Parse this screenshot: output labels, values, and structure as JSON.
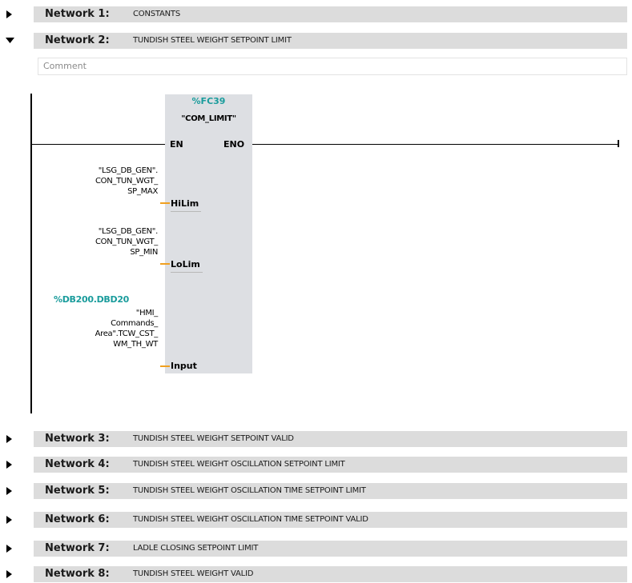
{
  "networks": [
    {
      "label": "Network 1:",
      "title": "CONSTANTS",
      "expanded": false
    },
    {
      "label": "Network 2:",
      "title": "TUNDISH STEEL WEIGHT SETPOINT LIMIT",
      "expanded": true
    },
    {
      "label": "Network 3:",
      "title": "TUNDISH STEEL WEIGHT SETPOINT VALID",
      "expanded": false
    },
    {
      "label": "Network 4:",
      "title": "TUNDISH STEEL WEIGHT OSCILLATION SETPOINT LIMIT",
      "expanded": false
    },
    {
      "label": "Network 5:",
      "title": "TUNDISH STEEL WEIGHT OSCILLATION TIME SETPOINT LIMIT",
      "expanded": false
    },
    {
      "label": "Network 6:",
      "title": "TUNDISH STEEL WEIGHT OSCILLATION TIME SETPOINT VALID",
      "expanded": false
    },
    {
      "label": "Network 7:",
      "title": "LADLE CLOSING SETPOINT LIMIT",
      "expanded": false
    },
    {
      "label": "Network 8:",
      "title": "TUNDISH STEEL WEIGHT VALID",
      "expanded": false
    }
  ],
  "comment": {
    "placeholder": "Comment"
  },
  "block": {
    "number": "%FC39",
    "name": "\"COM_LIMIT\"",
    "pins": {
      "en": "EN",
      "eno": "ENO",
      "hilim": "HiLim",
      "lolim": "LoLim",
      "input": "Input"
    }
  },
  "operands": {
    "hilim_lines": [
      "\"LSG_DB_GEN\".",
      "CON_TUN_WGT_",
      "SP_MAX"
    ],
    "lolim_lines": [
      "\"LSG_DB_GEN\".",
      "CON_TUN_WGT_",
      "SP_MIN"
    ],
    "input_address": "%DB200.DBD20",
    "input_lines": [
      "\"HMI_",
      "Commands_",
      "Area\".TCW_CST_",
      "WM_TH_WT"
    ]
  },
  "colors": {
    "header_bar": "#dcdcdc",
    "block_fill": "#dddfe3",
    "address_teal": "#1a9c9c",
    "wire_orange": "#f0a020"
  }
}
